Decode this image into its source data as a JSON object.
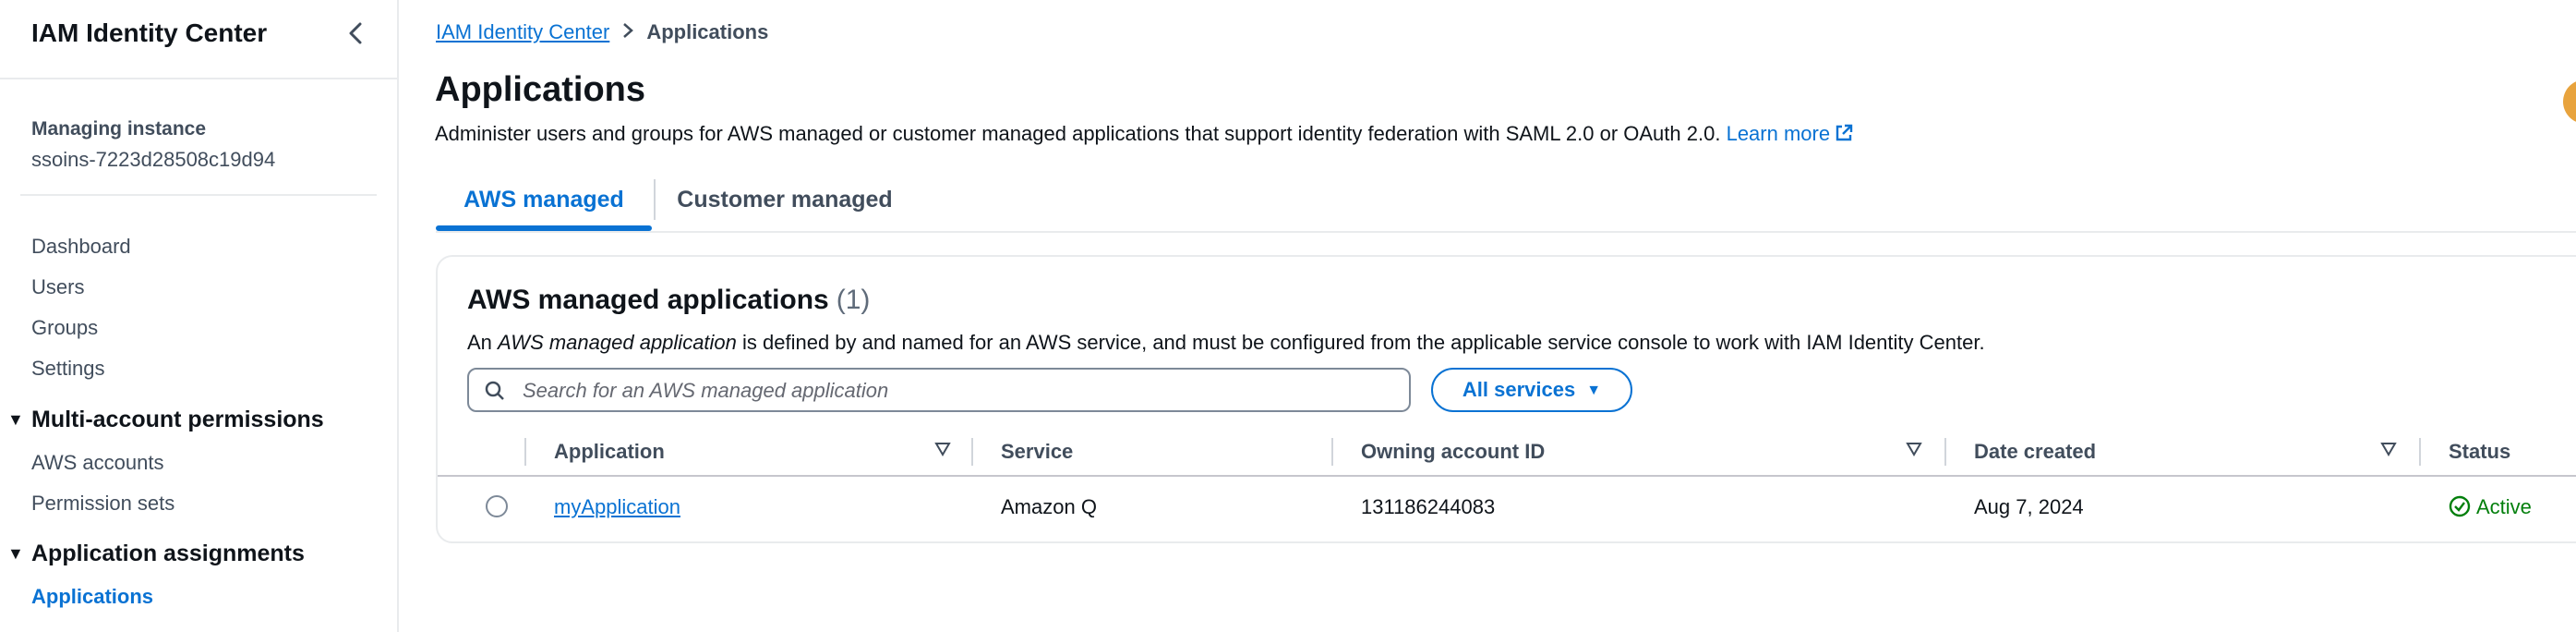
{
  "sidebar": {
    "title": "IAM Identity Center",
    "instance_label": "Managing instance",
    "instance_value": "ssoins-7223d28508c19d94",
    "links": [
      "Dashboard",
      "Users",
      "Groups",
      "Settings"
    ],
    "sections": [
      {
        "label": "Multi-account permissions",
        "items": [
          "AWS accounts",
          "Permission sets"
        ]
      },
      {
        "label": "Application assignments",
        "items": [
          "Applications"
        ]
      }
    ]
  },
  "breadcrumb": {
    "root": "IAM Identity Center",
    "current": "Applications"
  },
  "page": {
    "title": "Applications",
    "description": "Administer users and groups for AWS managed or customer managed applications that support identity federation with SAML 2.0 or OAuth 2.0.",
    "learn_more": "Learn more"
  },
  "tabs": [
    {
      "label": "AWS managed",
      "active": true
    },
    {
      "label": "Customer managed",
      "active": false
    }
  ],
  "panel": {
    "title": "AWS managed applications",
    "count": "(1)",
    "desc_pre": "An ",
    "desc_em": "AWS managed application",
    "desc_post": " is defined by and named for an AWS service, and must be configured from the applicable service console to work with IAM Identity Center.",
    "search_placeholder": "Search for an AWS managed application",
    "filter_label": "All services"
  },
  "table": {
    "columns": [
      "Application",
      "Service",
      "Owning account ID",
      "Date created",
      "Status"
    ],
    "rows": [
      {
        "application": "myApplication",
        "service": "Amazon Q",
        "account": "131186244083",
        "date": "Aug 7, 2024",
        "status": "Active"
      }
    ]
  },
  "colors": {
    "link": "#0972d3",
    "success": "#037f0c",
    "text": "#0f141a",
    "muted": "#414d5c"
  }
}
